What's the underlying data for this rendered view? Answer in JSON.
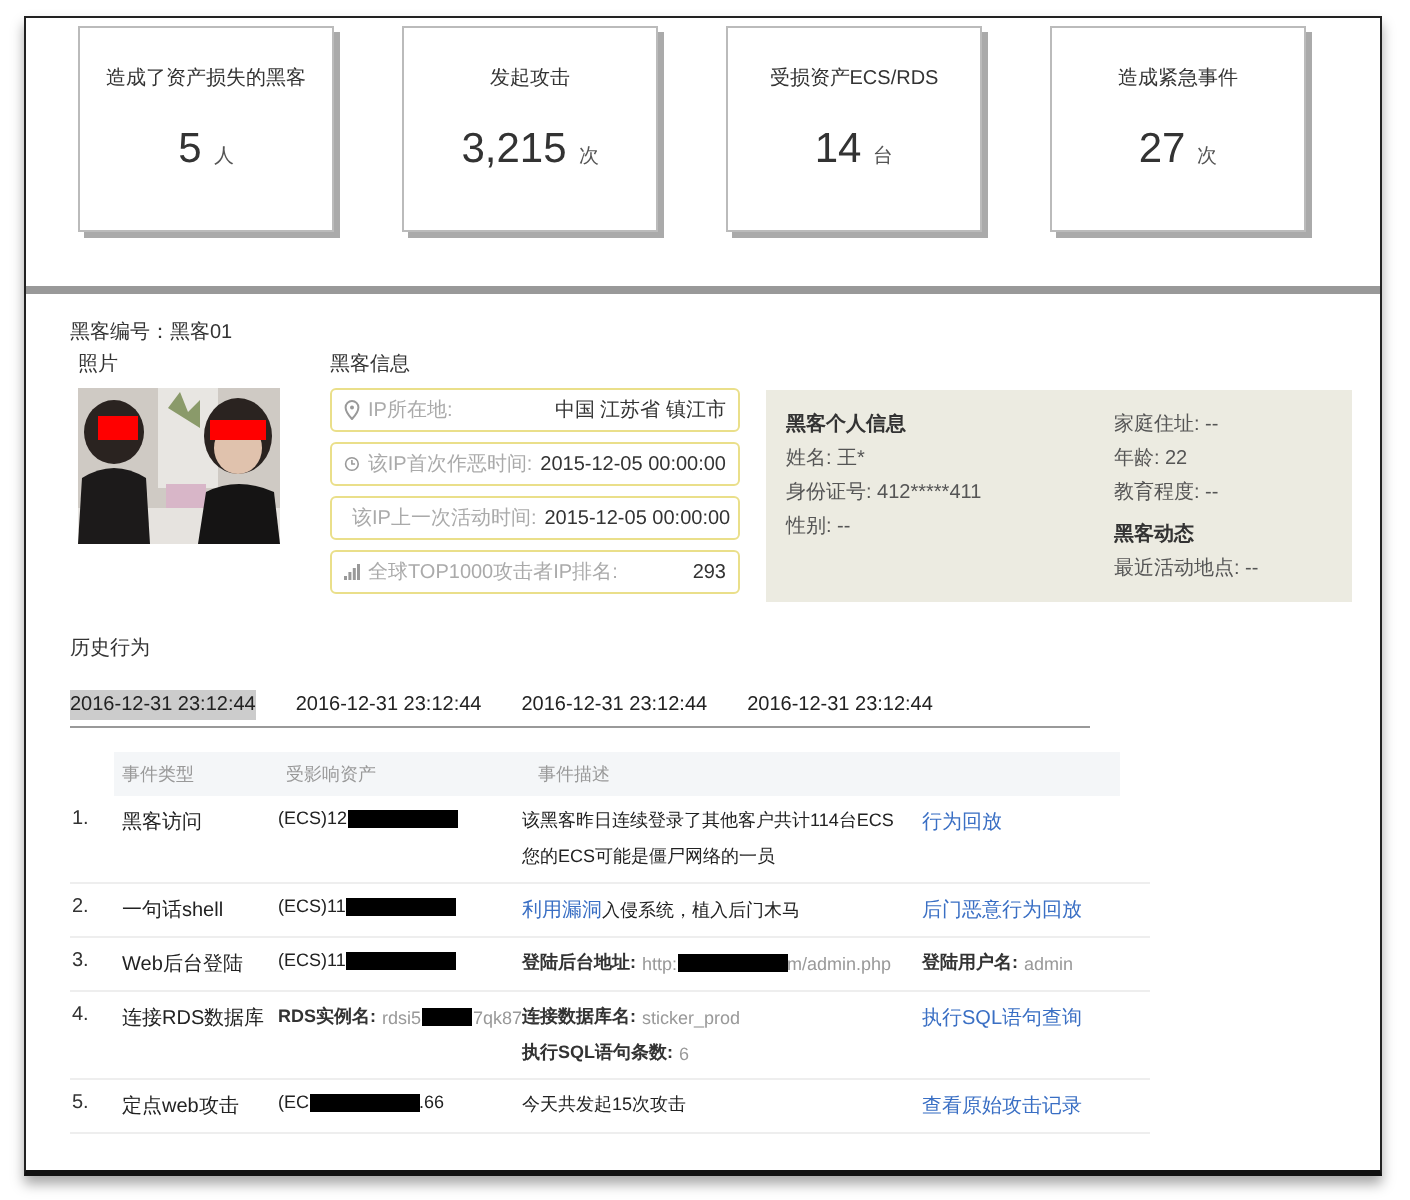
{
  "stats": [
    {
      "title": "造成了资产损失的黑客",
      "value": "5",
      "unit": "人"
    },
    {
      "title": "发起攻击",
      "value": "3,215",
      "unit": "次"
    },
    {
      "title": "受损资产ECS/RDS",
      "value": "14",
      "unit": "台"
    },
    {
      "title": "造成紧急事件",
      "value": "27",
      "unit": "次"
    }
  ],
  "hacker": {
    "id_label": "黑客编号：黑客01",
    "photo_label": "照片",
    "info_label": "黑客信息",
    "info": [
      {
        "kind": "location",
        "label": "IP所在地:",
        "value": "中国 江苏省 镇江市"
      },
      {
        "kind": "clock",
        "label": "该IP首次作恶时间:",
        "value": "2015-12-05 00:00:00"
      },
      {
        "kind": "clock",
        "label": "该IP上一次活动时间:",
        "value": "2015-12-05 00:00:00"
      },
      {
        "kind": "rank",
        "label": "全球TOP1000攻击者IP排名:",
        "value": "293"
      }
    ],
    "personal": {
      "left": [
        {
          "kind": "heading",
          "text": "黑客个人信息"
        },
        {
          "kind": "line",
          "text": "姓名: 王*"
        },
        {
          "kind": "line",
          "text": "身份证号: 412*****411"
        },
        {
          "kind": "line",
          "text": "性别: --"
        }
      ],
      "right": [
        {
          "kind": "line",
          "text": "家庭住址: --"
        },
        {
          "kind": "line",
          "text": "年龄: 22"
        },
        {
          "kind": "line",
          "text": "教育程度: --"
        },
        {
          "kind": "heading",
          "text": "黑客动态"
        },
        {
          "kind": "line",
          "text": "最近活动地点: --"
        }
      ]
    }
  },
  "history": {
    "title": "历史行为",
    "tabs": [
      {
        "label": "2016-12-31 23:12:44",
        "selected": true
      },
      {
        "label": "2016-12-31 23:12:44",
        "selected": false
      },
      {
        "label": "2016-12-31 23:12:44",
        "selected": false
      },
      {
        "label": "2016-12-31 23:12:44",
        "selected": false
      }
    ],
    "columns": [
      "事件类型",
      "受影响资产",
      "事件描述"
    ],
    "rows": [
      {
        "number": "1.",
        "type": "黑客访问",
        "asset": [
          [
            {
              "kind": "text",
              "text": "(ECS)12"
            },
            {
              "kind": "redacted"
            }
          ]
        ],
        "description": [
          [
            {
              "kind": "text",
              "text": "该黑客昨日连续登录了其他客户共计114台ECS"
            }
          ],
          [
            {
              "kind": "text",
              "text": "您的ECS可能是僵尸网络的一员"
            }
          ]
        ],
        "action": [
          [
            {
              "kind": "link",
              "text": "行为回放"
            }
          ]
        ]
      },
      {
        "number": "2.",
        "type": "一句话shell",
        "asset": [
          [
            {
              "kind": "text",
              "text": "(ECS)11"
            },
            {
              "kind": "redacted"
            }
          ]
        ],
        "description": [
          [
            {
              "kind": "link",
              "text": "利用漏洞"
            },
            {
              "kind": "text",
              "text": "入侵系统，植入后门木马"
            }
          ]
        ],
        "action": [
          [
            {
              "kind": "link",
              "text": "后门恶意行为回放"
            }
          ]
        ]
      },
      {
        "number": "3.",
        "type": "Web后台登陆",
        "asset": [
          [
            {
              "kind": "text",
              "text": "(ECS)11"
            },
            {
              "kind": "redacted"
            }
          ]
        ],
        "description": [
          [
            {
              "kind": "label",
              "text": "登陆后台地址:"
            },
            {
              "kind": "value",
              "text": "http:"
            },
            {
              "kind": "redacted"
            },
            {
              "kind": "value",
              "text": "m/admin.php"
            }
          ]
        ],
        "action": [
          [
            {
              "kind": "label",
              "text": "登陆用户名:"
            },
            {
              "kind": "value",
              "text": "admin"
            }
          ]
        ]
      },
      {
        "number": "4.",
        "type": "连接RDS数据库",
        "asset": [
          [
            {
              "kind": "label",
              "text": "RDS实例名:"
            },
            {
              "kind": "value",
              "text": "rdsi5"
            },
            {
              "kind": "redacted"
            },
            {
              "kind": "value",
              "text": "7qk87"
            }
          ]
        ],
        "description": [
          [
            {
              "kind": "label",
              "text": "连接数据库名:"
            },
            {
              "kind": "value",
              "text": "sticker_prod"
            }
          ],
          [
            {
              "kind": "label",
              "text": "执行SQL语句条数:"
            },
            {
              "kind": "value",
              "text": "6"
            }
          ]
        ],
        "action": [
          [
            {
              "kind": "link",
              "text": "执行SQL语句查询"
            }
          ]
        ]
      },
      {
        "number": "5.",
        "type": "定点web攻击",
        "asset": [
          [
            {
              "kind": "text",
              "text": "(EC"
            },
            {
              "kind": "redacted"
            },
            {
              "kind": "text",
              "text": ".66"
            }
          ]
        ],
        "description": [
          [
            {
              "kind": "text",
              "text": "今天共发起15次攻击"
            }
          ]
        ],
        "action": [
          [
            {
              "kind": "link",
              "text": "查看原始攻击记录"
            }
          ]
        ]
      }
    ]
  }
}
